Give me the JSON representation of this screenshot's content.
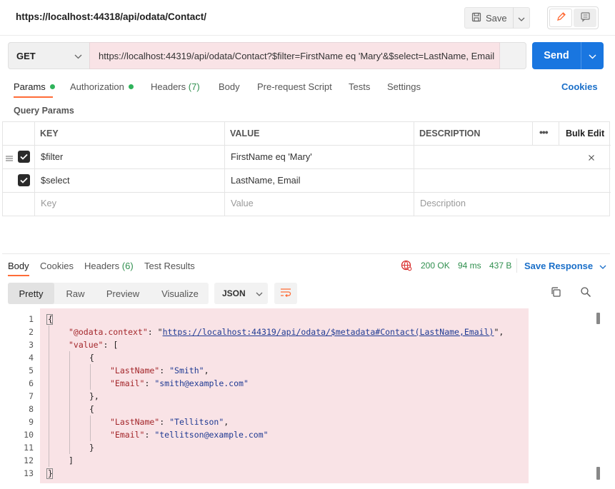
{
  "tab": {
    "title": "https://localhost:44318/api/odata/Contact/"
  },
  "toolbar": {
    "save_label": "Save"
  },
  "request": {
    "method": "GET",
    "url": "https://localhost:44319/api/odata/Contact?$filter=FirstName eq 'Mary'&$select=LastName, Email",
    "send_label": "Send"
  },
  "request_tabs": [
    {
      "label": "Params",
      "status": "green-dot"
    },
    {
      "label": "Authorization",
      "status": "green-dot"
    },
    {
      "label": "Headers",
      "count": "(7)"
    },
    {
      "label": "Body"
    },
    {
      "label": "Pre-request Script"
    },
    {
      "label": "Tests"
    },
    {
      "label": "Settings"
    }
  ],
  "cookies_label": "Cookies",
  "query_params": {
    "title": "Query Params",
    "headers": {
      "key": "KEY",
      "value": "VALUE",
      "description": "DESCRIPTION",
      "bulk_edit": "Bulk Edit"
    },
    "rows": [
      {
        "checked": true,
        "key": "$filter",
        "value": "FirstName eq 'Mary'",
        "description": ""
      },
      {
        "checked": true,
        "key": "$select",
        "value": "LastName, Email",
        "description": ""
      }
    ],
    "placeholders": {
      "key": "Key",
      "value": "Value",
      "description": "Description"
    }
  },
  "response": {
    "tabs": [
      {
        "label": "Body"
      },
      {
        "label": "Cookies"
      },
      {
        "label": "Headers",
        "count": "(6)"
      },
      {
        "label": "Test Results"
      }
    ],
    "status": "200 OK",
    "time": "94 ms",
    "size": "437 B",
    "save_response_label": "Save Response",
    "views": [
      "Pretty",
      "Raw",
      "Preview",
      "Visualize"
    ],
    "format": "JSON",
    "line_numbers": [
      "1",
      "2",
      "3",
      "4",
      "5",
      "6",
      "7",
      "8",
      "9",
      "10",
      "11",
      "12",
      "13"
    ],
    "json": {
      "context_key": "\"@odata.context\"",
      "context_url": "https://localhost:44319/api/odata/$metadata#Contact(LastName,Email)",
      "value_key": "\"value\"",
      "records": [
        {
          "lastname_key": "\"LastName\"",
          "lastname": "\"Smith\"",
          "email_key": "\"Email\"",
          "email": "\"smith@example.com\""
        },
        {
          "lastname_key": "\"LastName\"",
          "lastname": "\"Tellitson\"",
          "email_key": "\"Email\"",
          "email": "\"tellitson@example.com\""
        }
      ]
    }
  },
  "colors": {
    "accent": "#ff6c37",
    "primary": "#1976e0",
    "status_ok": "#2f8f4e",
    "highlight": "#f9e3e6"
  }
}
